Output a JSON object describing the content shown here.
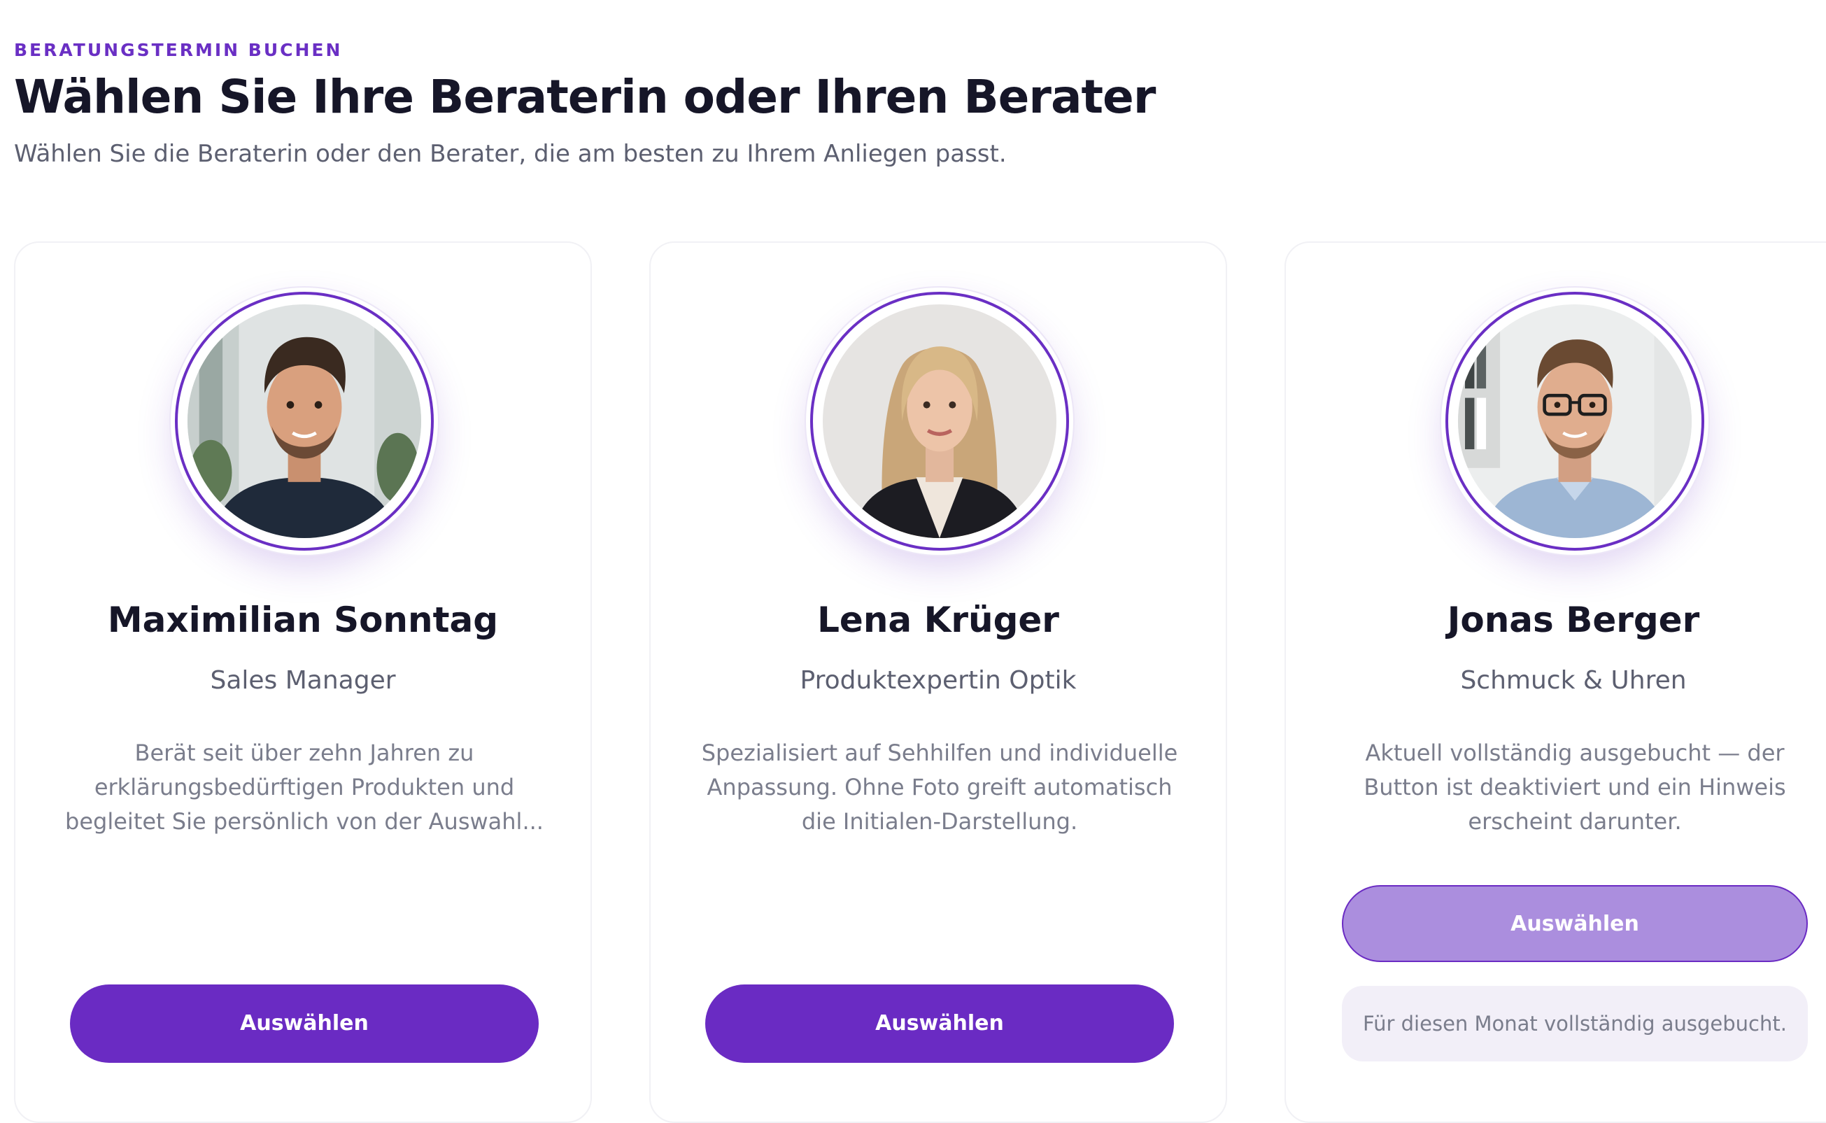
{
  "header": {
    "eyebrow": "BERATUNGSTERMIN BUCHEN",
    "title": "Wählen Sie Ihre Beraterin oder Ihren Berater",
    "subtitle": "Wählen Sie die Beraterin oder den Berater, die am besten zu Ihrem Anliegen passt."
  },
  "theme": {
    "accent": "#6a2bc3",
    "accent_disabled": "#ab8ede",
    "notice_bg": "#f2eff8"
  },
  "advisors": [
    {
      "name": "Maximilian Sonntag",
      "role": "Sales Manager",
      "description": "Berät seit über zehn Jahren zu erklärungsbedürftigen Produkten und begleitet Sie persönlich von der Auswahl...",
      "button_label": "Auswählen",
      "photo": "advisor-photo-man-dark-sweater"
    },
    {
      "name": "Lena Krüger",
      "role": "Produktexpertin Optik",
      "description": "Spezialisiert auf Sehhilfen und individuelle Anpassung. Ohne Foto greift automatisch die Initialen-Darstellung.",
      "button_label": "Auswählen",
      "photo": "advisor-photo-woman-blonde-blazer"
    },
    {
      "name": "Jonas Berger",
      "role": "Schmuck & Uhren",
      "description": "Aktuell vollständig ausgebucht — der Button ist deaktiviert und ein Hinweis erscheint darunter.",
      "button_label": "Auswählen",
      "photo": "advisor-photo-man-glasses-blue-shirt",
      "notice": "Für diesen Monat vollständig ausgebucht."
    }
  ]
}
